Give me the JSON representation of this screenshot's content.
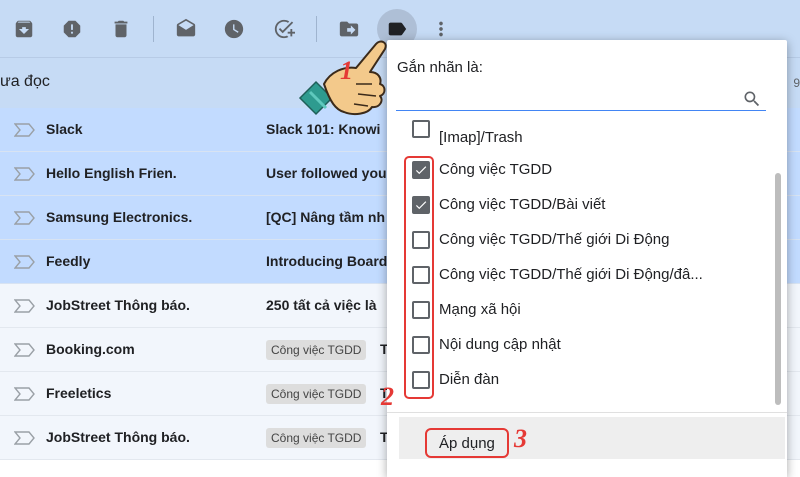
{
  "toolbar": {
    "buttons": [
      {
        "name": "archive-icon"
      },
      {
        "name": "report-spam-icon"
      },
      {
        "name": "delete-icon"
      },
      {
        "name": "mark-read-icon"
      },
      {
        "name": "snooze-icon"
      },
      {
        "name": "add-task-icon"
      },
      {
        "name": "move-to-icon"
      },
      {
        "name": "label-icon"
      },
      {
        "name": "more-vert-icon"
      }
    ]
  },
  "subheader": {
    "title": "ưa đọc",
    "count": "9"
  },
  "mails": [
    {
      "sender": "Slack",
      "subject": "Slack 101: Knowi",
      "selected": true
    },
    {
      "sender": "Hello English Frien.",
      "subject": "User followed you",
      "selected": true
    },
    {
      "sender": "Samsung Electronics.",
      "subject": "[QC] Nâng tầm nh",
      "selected": true
    },
    {
      "sender": "Feedly",
      "subject": "Introducing Board",
      "selected": true
    },
    {
      "sender": "JobStreet Thông báo.",
      "subject": "250 tất cả việc là",
      "selected": false
    },
    {
      "sender": "Booking.com",
      "chip": "Công việc TGDD",
      "after": "T",
      "selected": false
    },
    {
      "sender": "Freeletics",
      "chip": "Công việc TGDD",
      "after": "T",
      "selected": false
    },
    {
      "sender": "JobStreet Thông báo.",
      "chip": "Công việc TGDD",
      "after": "T",
      "selected": false
    }
  ],
  "label_menu": {
    "title": "Gắn nhãn là:",
    "search_value": "",
    "items": [
      {
        "label": "[Imap]/Trash",
        "checked": false
      },
      {
        "label": "Công việc TGDD",
        "checked": true
      },
      {
        "label": "Công việc TGDD/Bài viết",
        "checked": true
      },
      {
        "label": "Công việc TGDD/Thế giới Di Động",
        "checked": false
      },
      {
        "label": "Công việc TGDD/Thế giới Di Động/đâ...",
        "checked": false
      },
      {
        "label": "Mạng xã hội",
        "checked": false
      },
      {
        "label": "Nội dung cập nhật",
        "checked": false
      },
      {
        "label": "Diễn đàn",
        "checked": false
      }
    ],
    "apply_label": "Áp dụng"
  },
  "annotations": {
    "step1": "1",
    "step2": "2",
    "step3": "3",
    "color": "#e53935"
  },
  "colors": {
    "toolbar_bg": "#c6dbf5",
    "selected_row": "#c2dbff",
    "accent": "#4285f4"
  }
}
